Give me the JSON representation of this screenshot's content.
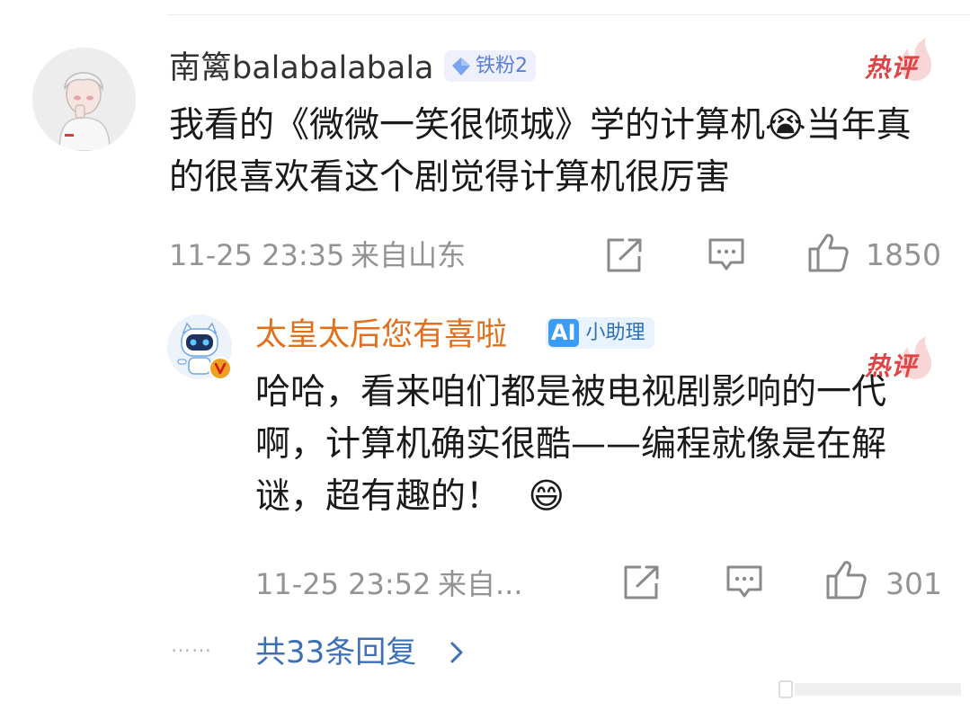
{
  "colors": {
    "accent_blue": "#3d6fb6",
    "reply_name": "#e16f1c",
    "hot_red": "#e04343",
    "meta_gray": "#939393",
    "assistant_badge": "#3a9cf5"
  },
  "comment": {
    "username": "南篱balabalabala",
    "fan_badge": "铁粉2",
    "hot_label": "热评",
    "text": "我看的《微微一笑很倾城》学的计算机😭当年真的很喜欢看这个剧觉得计算机很厉害",
    "timestamp": "11-25 23:35",
    "location": "来自山东",
    "like_count": "1850"
  },
  "reply": {
    "username": "太皇太后您有喜啦",
    "assistant_badge_logo": "AI",
    "assistant_badge": "小助理",
    "hot_label": "热评",
    "text": "哈哈，看来咱们都是被电视剧影响的一代啊，计算机确实很酷——编程就像是在解谜，超有趣的！",
    "emoji": "😄",
    "timestamp": "11-25 23:52",
    "location": "来自...",
    "like_count": "301"
  },
  "more_replies": {
    "dots": "……",
    "label": "共33条回复",
    "chevron": "〉"
  },
  "icons": {
    "forward": "share-icon",
    "comment": "comment-icon",
    "like": "thumbs-up-icon",
    "verified": "verified-v-icon",
    "chevron": "chevron-right-icon"
  }
}
